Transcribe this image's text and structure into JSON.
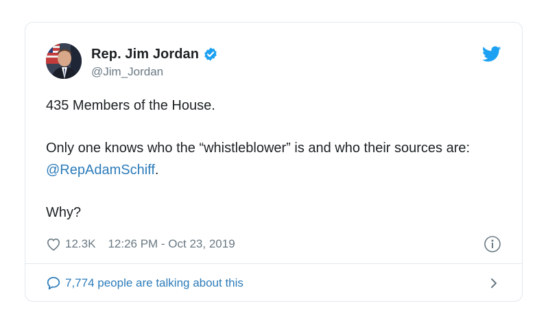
{
  "author": {
    "display_name": "Rep. Jim Jordan",
    "handle": "@Jim_Jordan",
    "avatar_icon": "profile-photo",
    "verified": true
  },
  "tweet": {
    "line1": "435 Members of the House.",
    "line2_before": "Only one knows who the “whistleblower” is and who their sources are: ",
    "mention": "@RepAdamSchiff",
    "line2_after": ".",
    "line3": "Why?"
  },
  "meta": {
    "likes": "12.3K",
    "timestamp": "12:26 PM - Oct 23, 2019"
  },
  "footer": {
    "talking_label": "7,774 people are talking about this"
  },
  "colors": {
    "link": "#2b7bb9",
    "twitter_blue": "#1da1f2",
    "muted": "#697882",
    "border": "#e1e8ed"
  }
}
